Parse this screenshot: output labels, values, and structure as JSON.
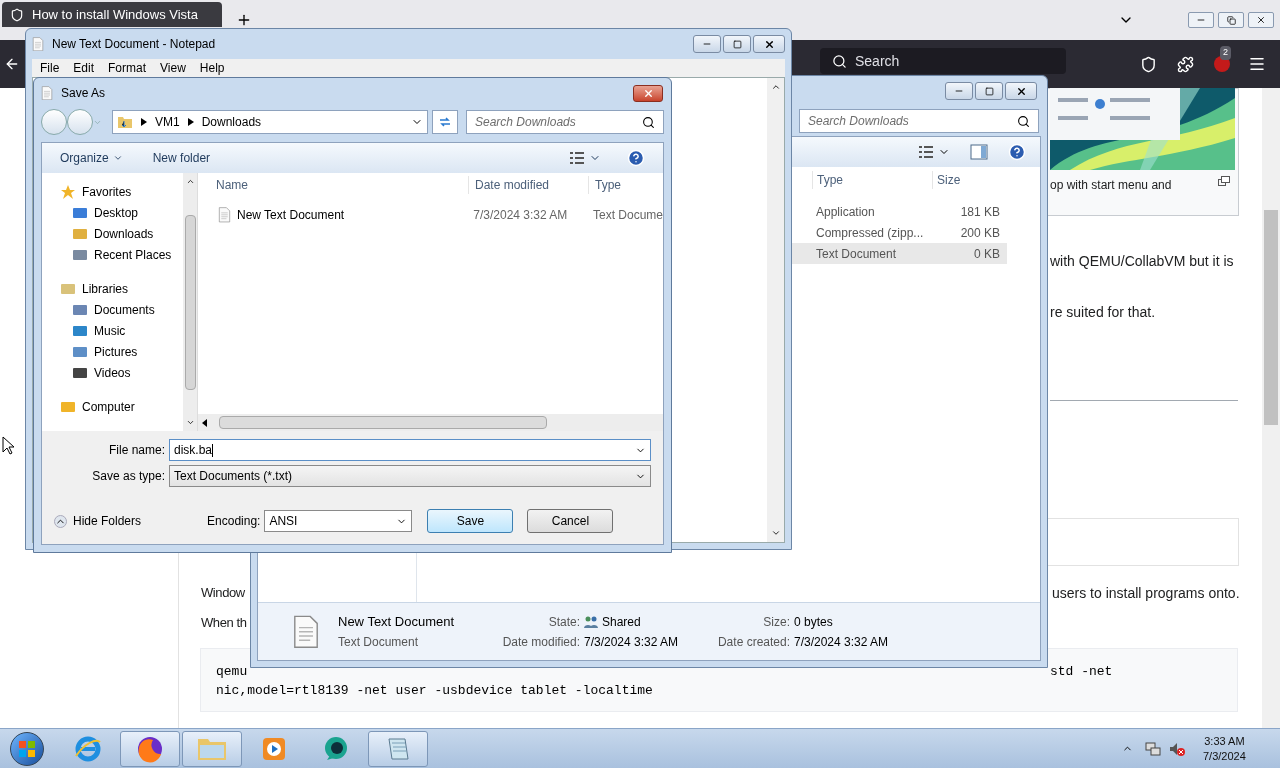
{
  "browser": {
    "tabs": [
      {
        "title": "How to install Windows Vista",
        "selected": true
      }
    ],
    "search_placeholder": "Search",
    "extension_badge": "2"
  },
  "page": {
    "caption": "op with start menu and",
    "paragraphs": [
      "with QEMU/CollabVM but it is",
      "re suited for that."
    ],
    "para_left": [
      "Window",
      "When th"
    ],
    "para_right": "users to install programs onto.",
    "code_line1_left": "qemu",
    "code_line1_right": "std -net",
    "code_line2": "nic,model=rtl8139 -net user -usbdevice tablet -localtime"
  },
  "explorer": {
    "search_placeholder": "Search Downloads",
    "columns": [
      "Type",
      "Size"
    ],
    "rows": [
      {
        "type": "Application",
        "size": "181 KB",
        "selected": false
      },
      {
        "type": "Compressed (zipp...",
        "size": "200 KB",
        "selected": false
      },
      {
        "type": "Text Document",
        "size": "0 KB",
        "selected": true
      }
    ],
    "details": {
      "name": "New Text Document",
      "kind": "Text Document",
      "state_label": "State:",
      "state": "Shared",
      "size_label": "Size:",
      "size": "0 bytes",
      "modified_label": "Date modified:",
      "modified": "7/3/2024 3:32 AM",
      "created_label": "Date created:",
      "created": "7/3/2024 3:32 AM"
    }
  },
  "notepad": {
    "title": "New Text Document - Notepad",
    "menu": [
      "File",
      "Edit",
      "Format",
      "View",
      "Help"
    ]
  },
  "save_as": {
    "title": "Save As",
    "breadcrumb": [
      "VM1",
      "Downloads"
    ],
    "search_placeholder": "Search Downloads",
    "toolbar": [
      "Organize",
      "New folder"
    ],
    "nav": [
      {
        "label": "Favorites",
        "children": [
          {
            "label": "Desktop"
          },
          {
            "label": "Downloads"
          },
          {
            "label": "Recent Places"
          }
        ]
      },
      {
        "label": "Libraries",
        "children": [
          {
            "label": "Documents"
          },
          {
            "label": "Music"
          },
          {
            "label": "Pictures"
          },
          {
            "label": "Videos"
          }
        ]
      },
      {
        "label": "Computer"
      }
    ],
    "columns": [
      "Name",
      "Date modified",
      "Type"
    ],
    "files": [
      {
        "name": "New Text Document",
        "modified": "7/3/2024 3:32 AM",
        "type": "Text Docume"
      }
    ],
    "file_name_label": "File name:",
    "file_name": "disk.ba",
    "type_label": "Save as type:",
    "type_value": "Text Documents (*.txt)",
    "hide_folders": "Hide Folders",
    "encoding_label": "Encoding:",
    "encoding": "ANSI",
    "buttons": [
      "Save",
      "Cancel"
    ]
  },
  "taskbar": {
    "apps": [
      {
        "kind": "ie",
        "running": false
      },
      {
        "kind": "firefox",
        "running": true
      },
      {
        "kind": "folder",
        "running": true
      },
      {
        "kind": "media",
        "running": false
      },
      {
        "kind": "chat",
        "running": false
      },
      {
        "kind": "notepad",
        "running": true
      }
    ],
    "time": "3:33 AM",
    "date": "7/3/2024"
  }
}
